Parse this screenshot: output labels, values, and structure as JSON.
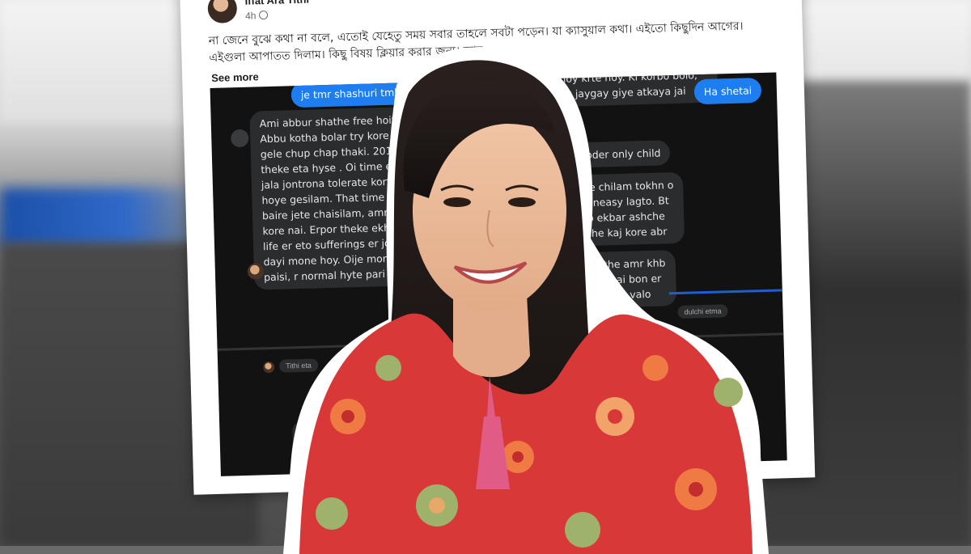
{
  "post": {
    "author": "Iffat Ara Tithi",
    "time": "4h",
    "text": "না জেনে বুঝে কথা না বলে, এতোই যেহেতু সময় সবার তাহলে সবটা পড়েন। যা ক্যাসুয়াল কথা। এইতো কিছুদিন আগের। এইগুলা আপাতত দিলাম। কিছু বিষয় ক্লিয়ার করার জন্য। আর",
    "see_more": "See more"
  },
  "chat": {
    "sent_1": "je tmr shashuri tmk kotha s",
    "right_gray_1": "r everyday tar shathe normal\nhoy krte hoy. Ki korbo bolo,\nek jaygay giye atkaya jai",
    "sent_2": "Ha shetai",
    "left_long": "Ami abbur shathe free hoite pari\nAbbu kotha bolar try kore ami s\ngele chup chap thaki. 2018 er\ntheke eta hyse . Oi time e am\njala jontrona tolerate korte n\nhoye gesilam. That time ami\nbaire jete chaisilam, amr bap\nkore nai. Erpor theke ekhn p\nlife er eto sufferings er jonno\ndayi mone hoy. Oije mon e ko\npaisi, r normal hyte pari na",
    "right_gray_2": "oder only child",
    "right_gray_3": "the chilam tokhn o\nr uneasy lagto. Bt\ntro ekbar ashche\neshe kaj kore abr",
    "sent_3": "Tu",
    "right_gray_4": "shathe amr khb\ntar bhai bon er\nEta amr valo",
    "tiny_1": "dulchi etma",
    "tiny_2": "Tithi eta"
  }
}
